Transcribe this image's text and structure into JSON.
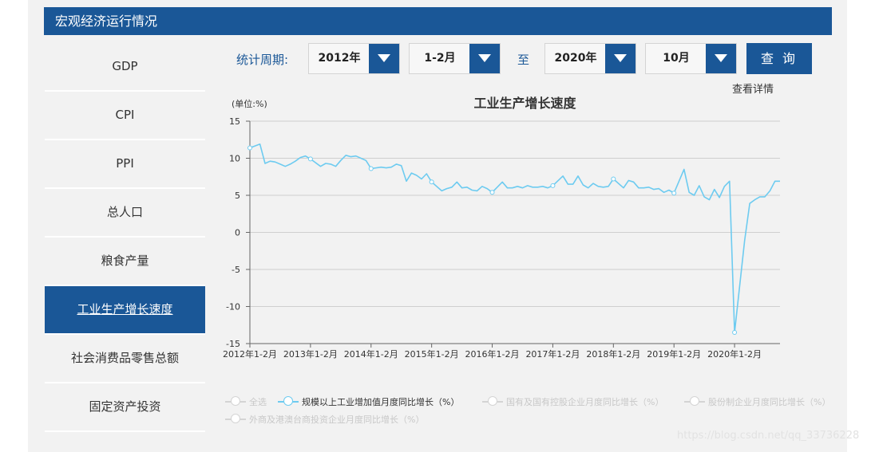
{
  "header": {
    "title": "宏观经济运行情况"
  },
  "sidebar": {
    "items": [
      {
        "label": "GDP"
      },
      {
        "label": "CPI"
      },
      {
        "label": "PPI"
      },
      {
        "label": "总人口"
      },
      {
        "label": "粮食产量"
      },
      {
        "label": "工业生产增长速度",
        "active": true
      },
      {
        "label": "社会消费品零售总额"
      },
      {
        "label": "固定资产投资"
      }
    ]
  },
  "toolbar": {
    "period_label": "统计周期:",
    "start_year": "2012年",
    "start_month": "1-2月",
    "to_label": "至",
    "end_year": "2020年",
    "end_month": "10月",
    "query_label": "查 询",
    "details_label": "查看详情"
  },
  "colors": {
    "accent": "#1a5797",
    "line": "#6dcbf0"
  },
  "chart_data": {
    "type": "line",
    "title": "工业生产增长速度",
    "unit_label": "(单位:%)",
    "ylim": [
      -15,
      15
    ],
    "yticks": [
      15,
      10,
      5,
      0,
      -5,
      -10,
      -15
    ],
    "grid": true,
    "x_ticks": [
      "2012年1-2月",
      "2013年1-2月",
      "2014年1-2月",
      "2015年1-2月",
      "2016年1-2月",
      "2017年1-2月",
      "2018年1-2月",
      "2019年1-2月",
      "2020年1-2月"
    ],
    "x": [
      "2012-01",
      "2012-03",
      "2012-04",
      "2012-05",
      "2012-06",
      "2012-07",
      "2012-08",
      "2012-09",
      "2012-10",
      "2012-11",
      "2012-12",
      "2013-01",
      "2013-03",
      "2013-04",
      "2013-05",
      "2013-06",
      "2013-07",
      "2013-08",
      "2013-09",
      "2013-10",
      "2013-11",
      "2013-12",
      "2014-01",
      "2014-03",
      "2014-04",
      "2014-05",
      "2014-06",
      "2014-07",
      "2014-08",
      "2014-09",
      "2014-10",
      "2014-11",
      "2014-12",
      "2015-01",
      "2015-03",
      "2015-04",
      "2015-05",
      "2015-06",
      "2015-07",
      "2015-08",
      "2015-09",
      "2015-10",
      "2015-11",
      "2015-12",
      "2016-01",
      "2016-03",
      "2016-04",
      "2016-05",
      "2016-06",
      "2016-07",
      "2016-08",
      "2016-09",
      "2016-10",
      "2016-11",
      "2016-12",
      "2017-01",
      "2017-03",
      "2017-04",
      "2017-05",
      "2017-06",
      "2017-07",
      "2017-08",
      "2017-09",
      "2017-10",
      "2017-11",
      "2017-12",
      "2018-01",
      "2018-03",
      "2018-04",
      "2018-05",
      "2018-06",
      "2018-07",
      "2018-08",
      "2018-09",
      "2018-10",
      "2018-11",
      "2018-12",
      "2019-01",
      "2019-03",
      "2019-04",
      "2019-05",
      "2019-06",
      "2019-07",
      "2019-08",
      "2019-09",
      "2019-10",
      "2019-11",
      "2019-12",
      "2020-01",
      "2020-03",
      "2020-04",
      "2020-05",
      "2020-06",
      "2020-07",
      "2020-08",
      "2020-09",
      "2020-10"
    ],
    "series": [
      {
        "name": "规模以上工业增加值月度同比增长（%）",
        "values": [
          11.4,
          11.9,
          9.3,
          9.6,
          9.5,
          9.2,
          8.9,
          9.2,
          9.6,
          10.1,
          10.3,
          9.9,
          8.9,
          9.3,
          9.2,
          8.9,
          9.7,
          10.4,
          10.2,
          10.3,
          10.0,
          9.7,
          8.6,
          8.8,
          8.7,
          8.8,
          9.2,
          9.0,
          6.9,
          8.0,
          7.7,
          7.2,
          7.9,
          6.8,
          5.6,
          5.9,
          6.1,
          6.8,
          6.0,
          6.1,
          5.7,
          5.6,
          6.2,
          5.9,
          5.4,
          6.8,
          6.0,
          6.0,
          6.2,
          6.0,
          6.3,
          6.1,
          6.1,
          6.2,
          6.0,
          6.3,
          7.6,
          6.5,
          6.5,
          7.6,
          6.4,
          6.0,
          6.6,
          6.2,
          6.1,
          6.2,
          7.2,
          6.0,
          7.0,
          6.8,
          6.0,
          6.0,
          6.1,
          5.8,
          5.9,
          5.4,
          5.7,
          5.3,
          8.5,
          5.4,
          5.0,
          6.3,
          4.8,
          4.4,
          5.8,
          4.7,
          6.2,
          6.9,
          -13.5,
          -1.1,
          3.9,
          4.4,
          4.8,
          4.8,
          5.6,
          6.9,
          6.9
        ]
      }
    ],
    "legend": [
      {
        "label": "全选",
        "on": false
      },
      {
        "label": "规模以上工业增加值月度同比增长（%）",
        "on": true
      },
      {
        "label": "国有及国有控股企业月度同比增长（%）",
        "on": false
      },
      {
        "label": "股份制企业月度同比增长（%）",
        "on": false
      },
      {
        "label": "外商及港澳台商投资企业月度同比增长（%）",
        "on": false
      }
    ]
  },
  "watermark": "https://blog.csdn.net/qq_33736228"
}
